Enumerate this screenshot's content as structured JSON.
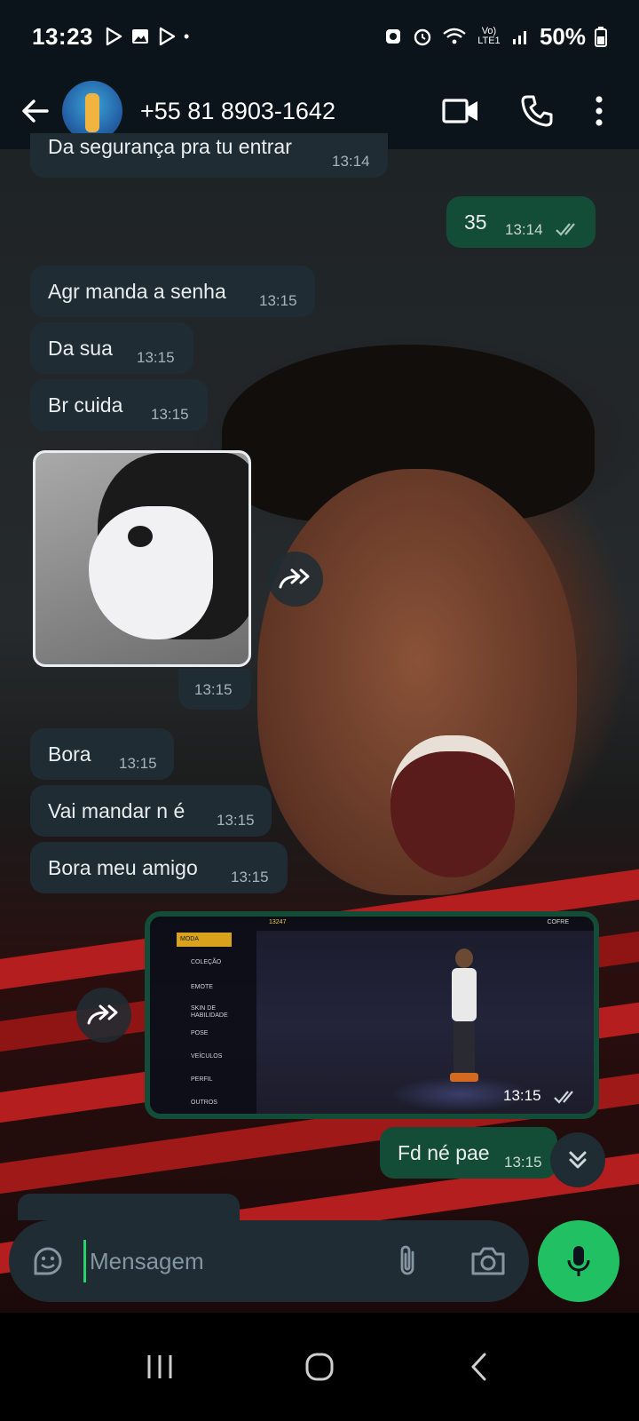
{
  "status_bar": {
    "time": "13:23",
    "network": "Vo) LTE1",
    "signal_label": "6",
    "battery": "50%"
  },
  "header": {
    "contact": "+55 81 8903-1642",
    "icons": [
      "back-arrow-icon",
      "video-call-icon",
      "voice-call-icon",
      "more-options-icon"
    ]
  },
  "messages": [
    {
      "direction": "in",
      "text": "Da segurança pra tu entrar",
      "time": "13:14"
    },
    {
      "direction": "out",
      "text": "35",
      "time": "13:14",
      "status": "read"
    },
    {
      "direction": "in",
      "text": "Agr manda a senha",
      "time": "13:15"
    },
    {
      "direction": "in",
      "text": "Da sua",
      "time": "13:15"
    },
    {
      "direction": "in",
      "text": "Br cuida",
      "time": "13:15"
    },
    {
      "direction": "in",
      "type": "image",
      "time": "13:15"
    },
    {
      "direction": "in",
      "text": "Bora",
      "time": "13:15"
    },
    {
      "direction": "in",
      "text": "Vai mandar n é",
      "time": "13:15"
    },
    {
      "direction": "in",
      "text": "Bora meu amigo",
      "time": "13:15"
    },
    {
      "direction": "out",
      "type": "image",
      "time": "13:15",
      "status": "read"
    },
    {
      "direction": "out",
      "text": "Fd né pae",
      "time": "13:15"
    }
  ],
  "game_screenshot": {
    "menu_items": [
      "MODA",
      "COLEÇÃO",
      "EMOTE",
      "SKIN DE HABILIDADE",
      "POSE",
      "VEÍCULOS",
      "PERFIL",
      "OUTROS"
    ],
    "top_right": "COFRE",
    "coins": "13247"
  },
  "composer": {
    "placeholder": "Mensagem"
  }
}
